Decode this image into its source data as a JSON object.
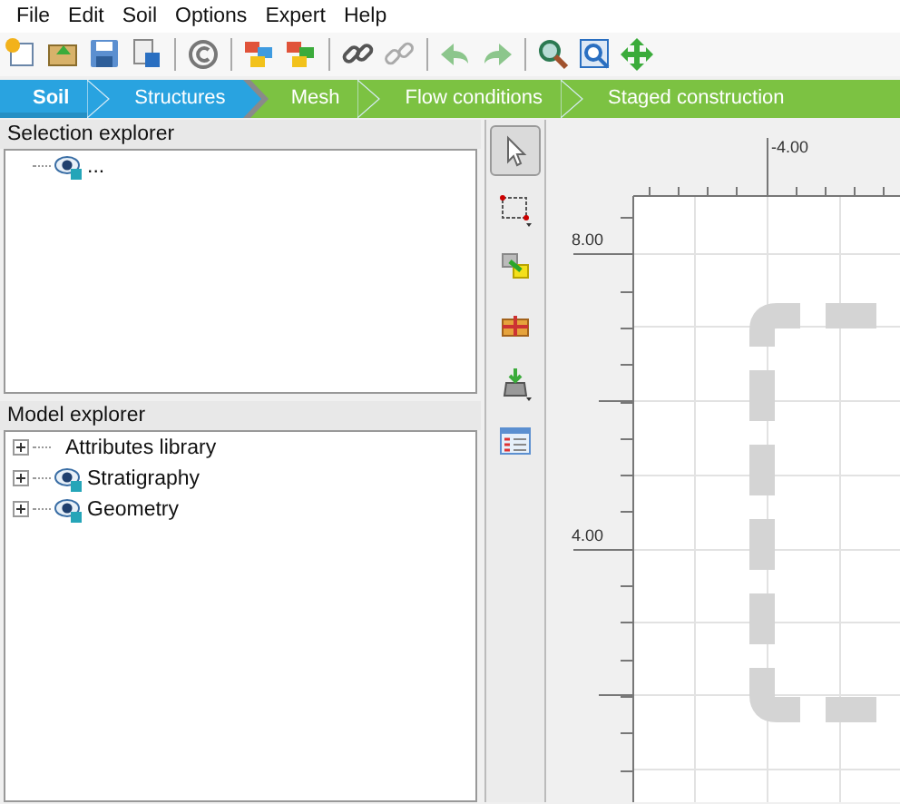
{
  "menu": [
    "File",
    "Edit",
    "Soil",
    "Options",
    "Expert",
    "Help"
  ],
  "mode_tabs": [
    {
      "label": "Soil",
      "selected": true,
      "color": "#29a3e0"
    },
    {
      "label": "Structures",
      "selected": false,
      "color": "#29a3e0"
    },
    {
      "label": "Mesh",
      "selected": false,
      "color": "#7cc242"
    },
    {
      "label": "Flow conditions",
      "selected": false,
      "color": "#7cc242"
    },
    {
      "label": "Staged construction",
      "selected": false,
      "color": "#7cc242"
    }
  ],
  "selection_explorer": {
    "title": "Selection explorer",
    "items": [
      {
        "label": "...",
        "kind": "layer"
      }
    ]
  },
  "model_explorer": {
    "title": "Model explorer",
    "items": [
      {
        "label": "Attributes library",
        "kind": "library",
        "expanded": false
      },
      {
        "label": "Stratigraphy",
        "kind": "layer",
        "expanded": false
      },
      {
        "label": "Geometry",
        "kind": "layer",
        "expanded": false
      }
    ]
  },
  "side_tools": [
    {
      "selected": true
    },
    {
      "selected": false
    },
    {
      "selected": false
    },
    {
      "selected": false
    },
    {
      "selected": false
    },
    {
      "selected": false
    }
  ],
  "canvas": {
    "x_ruler_labels": [
      "-4.00"
    ],
    "y_ruler_labels": [
      "8.00",
      "4.00"
    ]
  }
}
